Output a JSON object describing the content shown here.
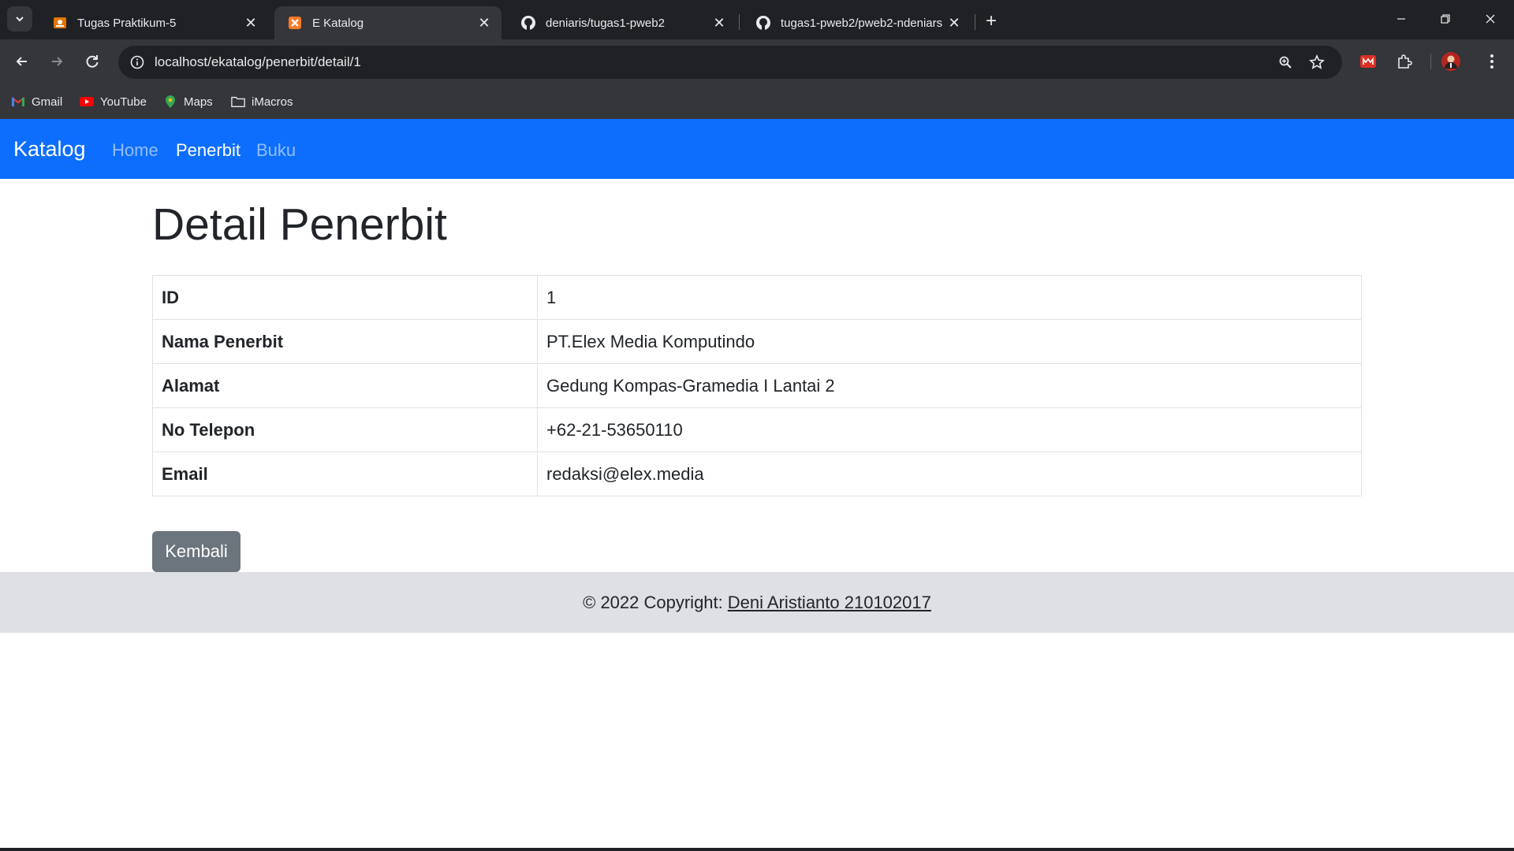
{
  "browser": {
    "tabs": [
      {
        "title": "Tugas Praktikum-5",
        "icon": "classroom-icon",
        "active": false
      },
      {
        "title": "E Katalog",
        "icon": "xampp-icon",
        "active": true
      },
      {
        "title": "deniaris/tugas1-pweb2",
        "icon": "github-icon",
        "active": false
      },
      {
        "title": "tugas1-pweb2/pweb2-ndeniars",
        "icon": "github-icon",
        "active": false
      }
    ],
    "url": "localhost/ekatalog/penerbit/detail/1",
    "bookmarks": [
      {
        "label": "Gmail",
        "icon": "gmail-icon"
      },
      {
        "label": "YouTube",
        "icon": "youtube-icon"
      },
      {
        "label": "Maps",
        "icon": "maps-icon"
      },
      {
        "label": "iMacros",
        "icon": "folder-icon"
      }
    ]
  },
  "site": {
    "brand": "Katalog",
    "nav": [
      {
        "label": "Home",
        "active": false
      },
      {
        "label": "Penerbit",
        "active": true
      },
      {
        "label": "Buku",
        "active": false
      }
    ]
  },
  "main": {
    "title": "Detail Penerbit",
    "rows": [
      {
        "label": "ID",
        "value": "1"
      },
      {
        "label": "Nama Penerbit",
        "value": "PT.Elex Media Komputindo"
      },
      {
        "label": "Alamat",
        "value": "Gedung Kompas-Gramedia I Lantai 2"
      },
      {
        "label": "No Telepon",
        "value": "+62-21-53650110"
      },
      {
        "label": "Email",
        "value": "redaksi@elex.media"
      }
    ],
    "back_label": "Kembali"
  },
  "footer": {
    "prefix": "© 2022 Copyright:",
    "link": "Deni Aristianto 210102017"
  },
  "colors": {
    "navbar": "#0d6efd",
    "button": "#6c757d",
    "footer": "#dee0e3"
  }
}
